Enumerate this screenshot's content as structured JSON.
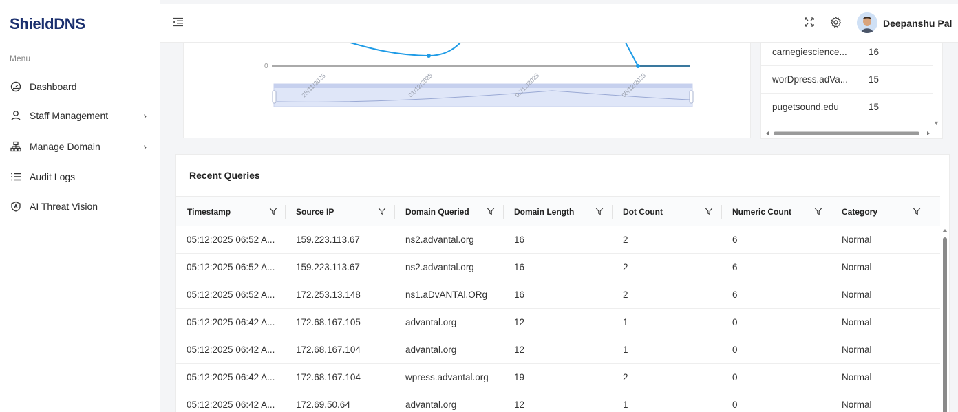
{
  "app": {
    "brand": "ShieldDNS"
  },
  "sidebar": {
    "menu_label": "Menu",
    "items": [
      {
        "label": "Dashboard",
        "icon": "dashboard-icon",
        "chevron": false
      },
      {
        "label": "Staff Management",
        "icon": "user-icon",
        "chevron": true
      },
      {
        "label": "Manage Domain",
        "icon": "sitemap-icon",
        "chevron": true
      },
      {
        "label": "Audit Logs",
        "icon": "list-icon",
        "chevron": false
      },
      {
        "label": "AI Threat Vision",
        "icon": "ai-shield-icon",
        "chevron": false
      }
    ]
  },
  "topbar": {
    "username": "Deepanshu Pal"
  },
  "chart_data": {
    "type": "line",
    "y_tick_label": "0",
    "x_tick_labels": [
      "28/11/2025",
      "01/12/2025",
      "02/12/2025",
      "05/12/2025"
    ],
    "series_color": "#1e9be6"
  },
  "top_domains": {
    "rows": [
      {
        "domain": "carnegiescience...",
        "count": "16"
      },
      {
        "domain": "worDpress.adVa...",
        "count": "15"
      },
      {
        "domain": "pugetsound.edu",
        "count": "15"
      }
    ]
  },
  "recent_queries": {
    "title": "Recent Queries",
    "columns": [
      "Timestamp",
      "Source IP",
      "Domain Queried",
      "Domain Length",
      "Dot Count",
      "Numeric Count",
      "Category"
    ],
    "rows": [
      [
        "05:12:2025 06:52 A...",
        "159.223.113.67",
        "ns2.advantal.org",
        "16",
        "2",
        "6",
        "Normal"
      ],
      [
        "05:12:2025 06:52 A...",
        "159.223.113.67",
        "ns2.advantal.org",
        "16",
        "2",
        "6",
        "Normal"
      ],
      [
        "05:12:2025 06:52 A...",
        "172.253.13.148",
        "ns1.aDvANTAl.ORg",
        "16",
        "2",
        "6",
        "Normal"
      ],
      [
        "05:12:2025 06:42 A...",
        "172.68.167.105",
        "advantal.org",
        "12",
        "1",
        "0",
        "Normal"
      ],
      [
        "05:12:2025 06:42 A...",
        "172.68.167.104",
        "advantal.org",
        "12",
        "1",
        "0",
        "Normal"
      ],
      [
        "05:12:2025 06:42 A...",
        "172.68.167.104",
        "wpress.advantal.org",
        "19",
        "2",
        "0",
        "Normal"
      ],
      [
        "05:12:2025 06:42 A...",
        "172.69.50.64",
        "advantal.org",
        "12",
        "1",
        "0",
        "Normal"
      ]
    ]
  },
  "colors": {
    "brand": "#1a2f6e",
    "accent": "#1e9be6",
    "zoom_fill": "#dfe6f8"
  }
}
